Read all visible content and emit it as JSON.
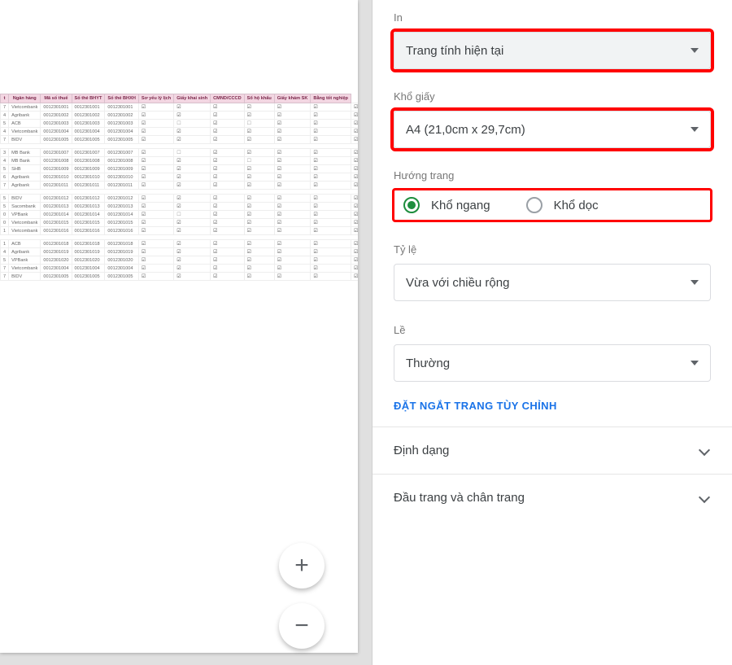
{
  "settings": {
    "print_label": "In",
    "print_value": "Trang tính hiện tại",
    "paper_label": "Khổ giấy",
    "paper_value": "A4 (21,0cm x 29,7cm)",
    "orientation_label": "Hướng trang",
    "orientation": {
      "landscape": "Khổ ngang",
      "portrait": "Khổ dọc",
      "selected": "landscape"
    },
    "scale_label": "Tỷ lệ",
    "scale_value": "Vừa với chiều rộng",
    "margins_label": "Lề",
    "margins_value": "Thường",
    "custom_breaks": "ĐẶT NGẮT TRANG TÙY CHỈNH",
    "format_section": "Định dạng",
    "headers_section": "Đầu trang và chân trang"
  },
  "zoom": {
    "in": "+",
    "out": "−"
  },
  "sheet": {
    "headers": [
      "t",
      "Ngân hàng",
      "Mã số thuế",
      "Số thẻ BHYT",
      "Số thẻ BHXH",
      "Sơ yếu lý lịch",
      "Giấy khai sinh",
      "CMND/CCCD",
      "Sổ hộ khẩu",
      "Giấy khám SK",
      "Bằng tốt nghiệp"
    ],
    "rows": [
      {
        "i": "7",
        "bank": "Vietcombank",
        "c1": "0012301001",
        "c2": "0012301001",
        "c3": "0012301001",
        "cb": [
          1,
          1,
          1,
          1,
          1,
          1,
          1
        ]
      },
      {
        "i": "4",
        "bank": "Agribank",
        "c1": "0012301002",
        "c2": "0012301002",
        "c3": "0012301002",
        "cb": [
          1,
          1,
          1,
          1,
          1,
          1,
          1
        ]
      },
      {
        "i": "5",
        "bank": "ACB",
        "c1": "0012301003",
        "c2": "0012301003",
        "c3": "0012301003",
        "cb": [
          1,
          0,
          1,
          0,
          1,
          1,
          1
        ]
      },
      {
        "i": "4",
        "bank": "Vietcombank",
        "c1": "0012301004",
        "c2": "0012301004",
        "c3": "0012301004",
        "cb": [
          1,
          1,
          1,
          1,
          1,
          1,
          1
        ]
      },
      {
        "i": "7",
        "bank": "BIDV",
        "c1": "0012301005",
        "c2": "0012301005",
        "c3": "0012301005",
        "cb": [
          1,
          1,
          1,
          1,
          1,
          1,
          1
        ]
      },
      {
        "gap": true
      },
      {
        "i": "3",
        "bank": "MB Bank",
        "c1": "0012301007",
        "c2": "0012301007",
        "c3": "0012301007",
        "cb": [
          1,
          0,
          1,
          1,
          1,
          1,
          1
        ]
      },
      {
        "i": "4",
        "bank": "MB Bank",
        "c1": "0012301008",
        "c2": "0012301008",
        "c3": "0012301008",
        "cb": [
          1,
          1,
          1,
          0,
          1,
          1,
          1
        ]
      },
      {
        "i": "5",
        "bank": "SHB",
        "c1": "0012301009",
        "c2": "0012301009",
        "c3": "0012301009",
        "cb": [
          1,
          1,
          1,
          1,
          1,
          1,
          1
        ]
      },
      {
        "i": "6",
        "bank": "Agribank",
        "c1": "0012301010",
        "c2": "0012301010",
        "c3": "0012301010",
        "cb": [
          1,
          1,
          1,
          1,
          1,
          1,
          1
        ]
      },
      {
        "i": "7",
        "bank": "Agribank",
        "c1": "0012301011",
        "c2": "0012301011",
        "c3": "0012301011",
        "cb": [
          1,
          1,
          1,
          1,
          1,
          1,
          1
        ]
      },
      {
        "gap": true
      },
      {
        "i": "5",
        "bank": "BIDV",
        "c1": "0012301012",
        "c2": "0012301012",
        "c3": "0012301012",
        "cb": [
          1,
          1,
          1,
          1,
          1,
          1,
          1
        ]
      },
      {
        "i": "5",
        "bank": "Sacombank",
        "c1": "0012301013",
        "c2": "0012301013",
        "c3": "0012301013",
        "cb": [
          1,
          1,
          1,
          1,
          1,
          1,
          1
        ]
      },
      {
        "i": "0",
        "bank": "VPBank",
        "c1": "0012301014",
        "c2": "0012301014",
        "c3": "0012301014",
        "cb": [
          1,
          0,
          1,
          1,
          1,
          1,
          1
        ]
      },
      {
        "i": "0",
        "bank": "Vietcombank",
        "c1": "0012301015",
        "c2": "0012301015",
        "c3": "0012301015",
        "cb": [
          1,
          1,
          1,
          1,
          1,
          1,
          1
        ]
      },
      {
        "i": "1",
        "bank": "Vietcombank",
        "c1": "0012301016",
        "c2": "0012301016",
        "c3": "0012301016",
        "cb": [
          1,
          1,
          1,
          1,
          1,
          1,
          1
        ]
      },
      {
        "gap": true
      },
      {
        "i": "1",
        "bank": "ACB",
        "c1": "0012301018",
        "c2": "0012301018",
        "c3": "0012301018",
        "cb": [
          1,
          1,
          1,
          1,
          1,
          1,
          1
        ]
      },
      {
        "i": "4",
        "bank": "Agribank",
        "c1": "0012301019",
        "c2": "0012301019",
        "c3": "0012301019",
        "cb": [
          1,
          1,
          1,
          1,
          1,
          1,
          1
        ]
      },
      {
        "i": "5",
        "bank": "VPBank",
        "c1": "0012301020",
        "c2": "0012301020",
        "c3": "0012301020",
        "cb": [
          1,
          1,
          1,
          1,
          1,
          1,
          1
        ]
      },
      {
        "i": "7",
        "bank": "Vietcombank",
        "c1": "0012301004",
        "c2": "0012301004",
        "c3": "0012301004",
        "cb": [
          1,
          1,
          1,
          1,
          1,
          1,
          1
        ]
      },
      {
        "i": "7",
        "bank": "BIDV",
        "c1": "0012301005",
        "c2": "0012301005",
        "c3": "0012301005",
        "cb": [
          1,
          1,
          1,
          1,
          1,
          1,
          1
        ]
      }
    ]
  }
}
